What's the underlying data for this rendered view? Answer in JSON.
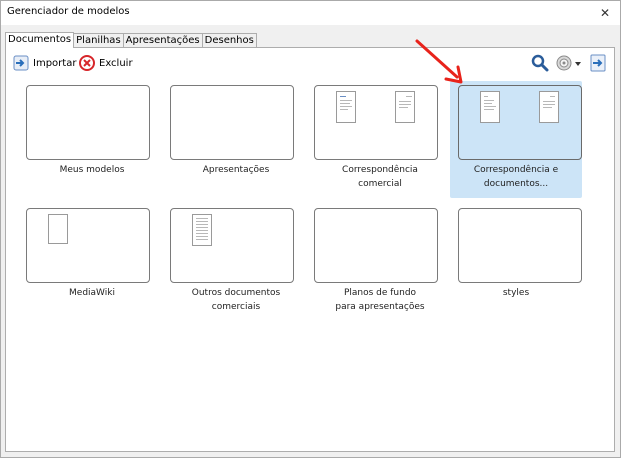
{
  "window": {
    "title": "Gerenciador de modelos",
    "close_symbol": "✕"
  },
  "tabs": [
    {
      "label": "Documentos",
      "active": true
    },
    {
      "label": "Planilhas",
      "active": false
    },
    {
      "label": "Apresentações",
      "active": false
    },
    {
      "label": "Desenhos",
      "active": false
    }
  ],
  "toolbar": {
    "import_label": "Importar",
    "import_icon": "import-arrow-icon",
    "delete_label": "Excluir",
    "delete_icon": "delete-circle-icon",
    "right_icons": [
      "search-icon",
      "gear-icon",
      "dropdown-arrow-icon",
      "export-icon"
    ]
  },
  "folders": [
    {
      "label_line1": "Meus modelos",
      "label_line2": "",
      "selected": false,
      "thumbs": "empty"
    },
    {
      "label_line1": "Apresentações",
      "label_line2": "",
      "selected": false,
      "thumbs": "empty"
    },
    {
      "label_line1": "Correspondência",
      "label_line2": "comercial",
      "selected": false,
      "thumbs": "two-docs"
    },
    {
      "label_line1": "Correspondência e",
      "label_line2": "documentos...",
      "selected": true,
      "thumbs": "two-docs"
    },
    {
      "label_line1": "MediaWiki",
      "label_line2": "",
      "selected": false,
      "thumbs": "one-blank"
    },
    {
      "label_line1": "Outros documentos",
      "label_line2": "comerciais",
      "selected": false,
      "thumbs": "one-doc"
    },
    {
      "label_line1": "Planos de fundo",
      "label_line2": "para apresentações",
      "selected": false,
      "thumbs": "empty"
    },
    {
      "label_line1": "styles",
      "label_line2": "",
      "selected": false,
      "thumbs": "empty"
    }
  ],
  "colors": {
    "selection": "#cce4f7",
    "annotation_arrow": "#e8231b",
    "delete_icon": "#d7262a",
    "accent_blue": "#2a6fbb"
  }
}
